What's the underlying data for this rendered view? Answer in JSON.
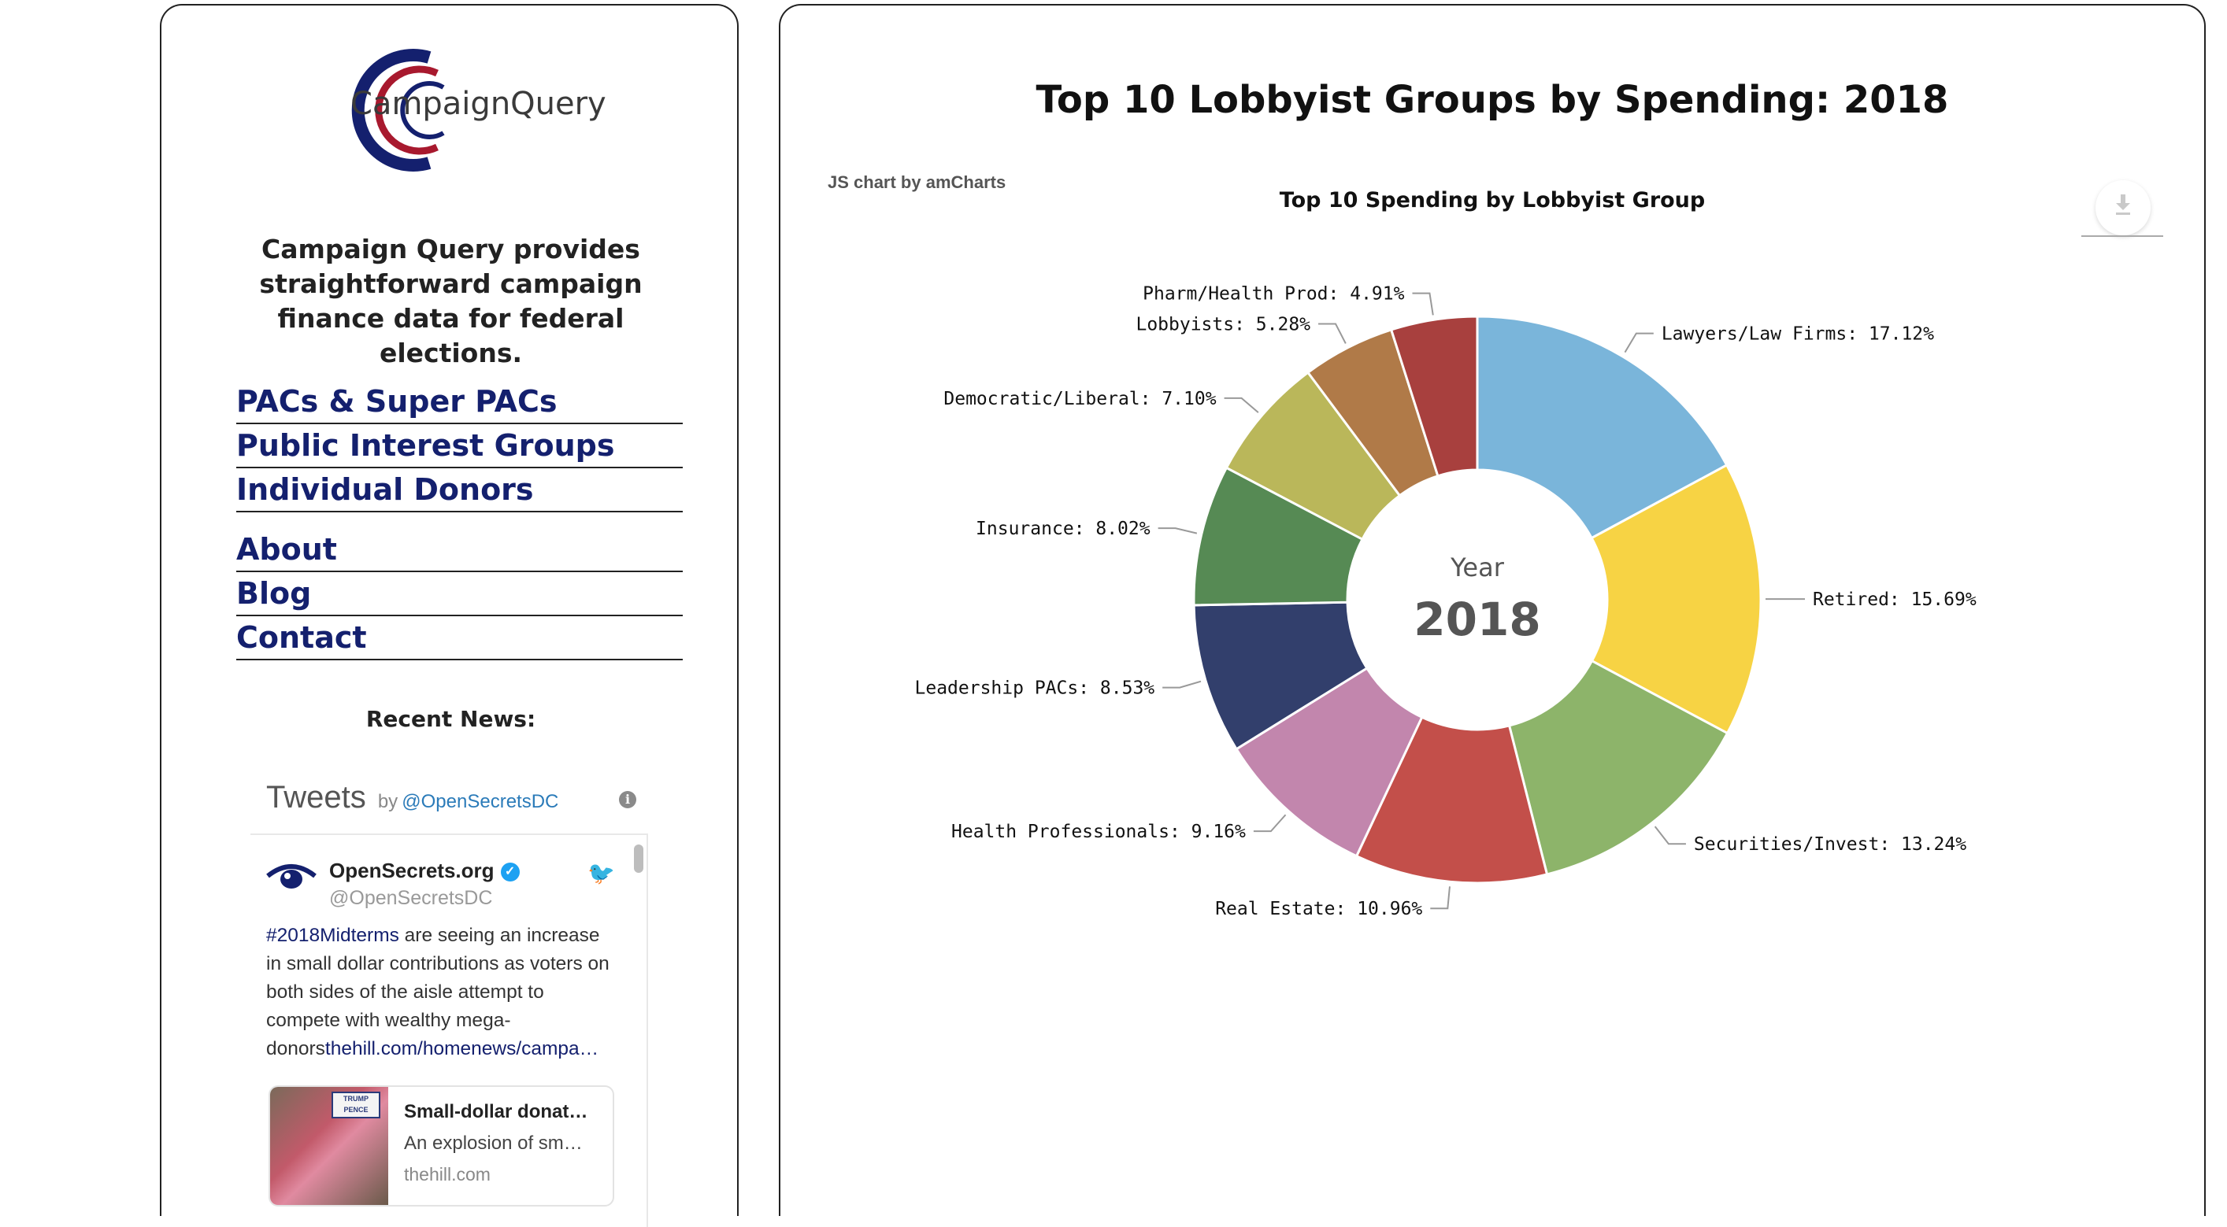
{
  "brand": {
    "name": "CampaignQuery",
    "colors": {
      "red": "#a8192e",
      "navy": "#14206e"
    }
  },
  "tagline": "Campaign Query provides straightforward campaign finance data for federal elections.",
  "nav_main": [
    {
      "label": "PACs & Super PACs"
    },
    {
      "label": "Public Interest Groups"
    },
    {
      "label": "Individual Donors"
    }
  ],
  "nav_secondary": [
    {
      "label": "About"
    },
    {
      "label": "Blog"
    },
    {
      "label": "Contact"
    }
  ],
  "recent_news": {
    "heading": "Recent News:"
  },
  "tweets": {
    "title": "Tweets",
    "by": "by",
    "handle": "@OpenSecretsDC",
    "tweet": {
      "name": "OpenSecrets.org",
      "handle": "@OpenSecretsDC",
      "hashtag": "#2018Midterms",
      "text": " are seeing an increase in small dollar contributions as voters on both sides of the aisle attempt to compete with wealthy mega-donors",
      "link": "thehill.com/homenews/campa…",
      "card": {
        "title": "Small-dollar donat…",
        "description": "An explosion of sm…",
        "domain": "thehill.com",
        "sign_text": "TRUMP PENCE"
      }
    }
  },
  "page_title": "Top 10 Lobbyist Groups by Spending: 2018",
  "chart_credit": "JS chart by amCharts",
  "chart_data": {
    "type": "pie",
    "title": "Top 10 Spending by Lobbyist Group",
    "center_label": "Year",
    "center_value": "2018",
    "slices": [
      {
        "label": "Lawyers/Law Firms: 17.12%",
        "value": 17.12,
        "color": "#7ab5da"
      },
      {
        "label": "Retired: 15.69%",
        "value": 15.69,
        "color": "#f7d344"
      },
      {
        "label": "Securities/Invest: 13.24%",
        "value": 13.24,
        "color": "#8db46a"
      },
      {
        "label": "Real Estate: 10.96%",
        "value": 10.96,
        "color": "#c34f4a"
      },
      {
        "label": "Health Professionals: 9.16%",
        "value": 9.16,
        "color": "#c286ad"
      },
      {
        "label": "Leadership PACs: 8.53%",
        "value": 8.53,
        "color": "#323f6c"
      },
      {
        "label": "Insurance: 8.02%",
        "value": 8.02,
        "color": "#568a54"
      },
      {
        "label": "Democratic/Liberal: 7.10%",
        "value": 7.1,
        "color": "#bab75a"
      },
      {
        "label": "Lobbyists: 5.28%",
        "value": 5.28,
        "color": "#b07a48"
      },
      {
        "label": "Pharm/Health Prod: 4.91%",
        "value": 4.91,
        "color": "#a8403e"
      }
    ]
  }
}
